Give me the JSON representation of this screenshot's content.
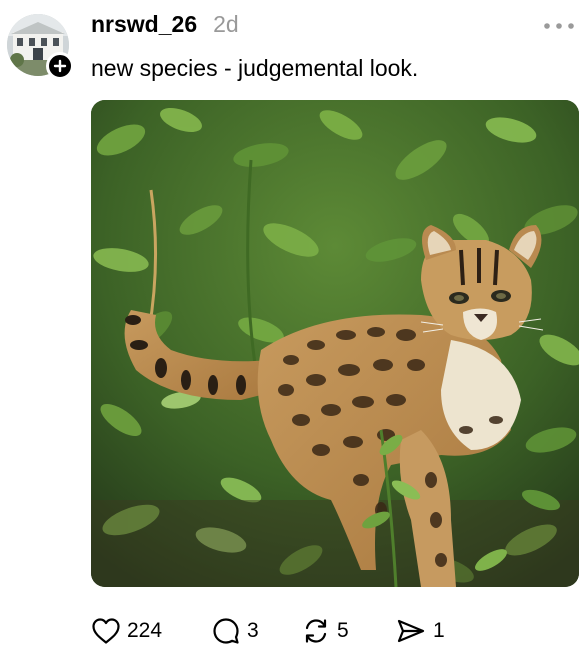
{
  "post": {
    "username": "nrswd_26",
    "timestamp": "2d",
    "caption": "new species - judgemental look.",
    "stats": {
      "likes": "224",
      "replies": "3",
      "reposts": "5",
      "shares": "1"
    }
  },
  "icons": {
    "avatar": "building-photo",
    "follow": "plus-icon",
    "more": "more-horizontal-icon",
    "like": "heart-icon",
    "reply": "comment-icon",
    "repost": "repost-icon",
    "share": "send-icon"
  },
  "colors": {
    "text": "#000000",
    "muted": "#999999",
    "background": "#ffffff"
  }
}
